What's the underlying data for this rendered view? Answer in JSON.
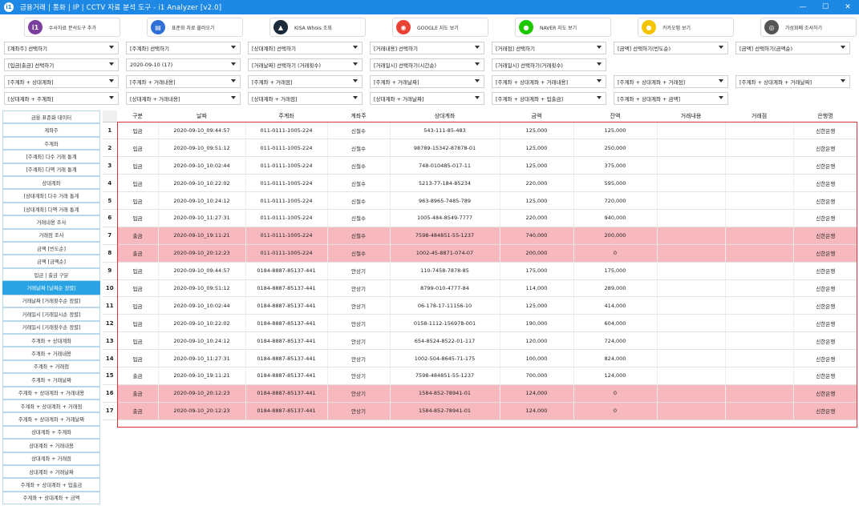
{
  "window": {
    "title": "금융거래 | 통화 | IP | CCTV 자료 분석 도구 - i1 Analyzer [v2.0]",
    "app_icon": "i1",
    "minimize": "—",
    "maximize": "☐",
    "close": "✕"
  },
  "toolbar": [
    {
      "label": "수사자료 분석도구 추가",
      "icon": "i1",
      "color": "#7b3fa0"
    },
    {
      "label": "표준화 자료 불러오기",
      "icon": "▤",
      "color": "#2f6fd6"
    },
    {
      "label": "KISA Whois 조회",
      "icon": "▲",
      "color": "#1b2b3a"
    },
    {
      "label": "GOOGLE 지도 보기",
      "icon": "◉",
      "color": "#e94235"
    },
    {
      "label": "NAVER 지도 보기",
      "icon": "●",
      "color": "#1ec800"
    },
    {
      "label": "카카오맵 보기",
      "icon": "●",
      "color": "#f4c400"
    },
    {
      "label": "가상화폐 조사하기",
      "icon": "◎",
      "color": "#555555"
    }
  ],
  "dropdowns": {
    "r1": [
      "[계좌주] 선택하기",
      "[주계좌] 선택하기",
      "[상대계좌] 선택하기",
      "[거래내용] 선택하기",
      "[거래점] 선택하기",
      "[금액] 선택하기(빈도순)",
      "[금액] 선택하기(금액순)"
    ],
    "r2": [
      "[입금|출금] 선택하기",
      "2020-09-10 (17)",
      "[거래날짜] 선택하기 (거래횟수)",
      "[거래일시] 선택하기(시간순)",
      "[거래일시] 선택하기(거래횟수)"
    ],
    "r3": [
      "[주계좌 + 상대계좌]",
      "[주계좌 + 거래내용]",
      "[주계좌 + 거래점]",
      "[주계좌 + 거래날짜]",
      "[주계좌 + 상대계좌 + 거래내용]",
      "[주계좌 + 상대계좌 + 거래점]",
      "[주계좌 + 상대계좌 + 거래날짜]"
    ],
    "r4": [
      "[상대계좌 + 주계좌]",
      "[상대계좌 + 거래내용]",
      "[상대계좌 + 거래점]",
      "[상대계좌 + 거래날짜]",
      "[주계좌 + 상대계좌 + 입출금]",
      "[주계좌 + 상대계좌 + 금액]"
    ]
  },
  "sidebar": [
    "금융 표준화 데이터",
    "계좌주",
    "주계좌",
    "[주계좌] 다수 거래 통계",
    "[주계좌] 다액 거래 통계",
    "상대계좌",
    "[상대계좌] 다수 거래 통계",
    "[상대계좌] 다액 거래 통계",
    "거래내용 조사",
    "거래점 조사",
    "금액 [빈도순]",
    "금액 [금액순]",
    "입금 | 출금 구분",
    "거래날짜 [날짜순 정렬]",
    "거래날짜 [거래횟수순 정렬]",
    "거래일시 [거래일시순 정렬]",
    "거래일시 [거래횟수순 정렬]",
    "주계좌 + 상대계좌",
    "주계좌 + 거래내용",
    "주계좌 + 거래점",
    "주계좌 + 거래날짜",
    "주계좌 + 상대계좌 + 거래내용",
    "주계좌 + 상대계좌 + 거래점",
    "주계좌 + 상대계좌 + 거래날짜",
    "상대계좌 + 주계좌",
    "상대계좌 + 거래내용",
    "상대계좌 + 거래점",
    "상대계좌 + 거래날짜",
    "주계좌 + 상대계좌 + 입출금",
    "주계좌 + 상대계좌 + 금액"
  ],
  "sidebar_active": "거래날짜 [날짜순 정렬]",
  "table": {
    "columns": [
      "구분",
      "날짜",
      "주계좌",
      "계좌주",
      "상대계좌",
      "금액",
      "잔액",
      "거래내용",
      "거래점",
      "은행명"
    ],
    "rows": [
      {
        "n": "1",
        "highlight": false,
        "cells": [
          "입금",
          "2020-09-10_09:44:57",
          "011-0111-1005-224",
          "신철수",
          "543-111-85-483",
          "125,000",
          "125,000",
          "",
          "",
          "신한은행"
        ]
      },
      {
        "n": "2",
        "highlight": false,
        "cells": [
          "입금",
          "2020-09-10_09:51:12",
          "011-0111-1005-224",
          "신철수",
          "98789-15342-87878-01",
          "125,000",
          "250,000",
          "",
          "",
          "신한은행"
        ]
      },
      {
        "n": "3",
        "highlight": false,
        "cells": [
          "입금",
          "2020-09-10_10:02:44",
          "011-0111-1005-224",
          "신철수",
          "748-010485-017-11",
          "125,000",
          "375,000",
          "",
          "",
          "신한은행"
        ]
      },
      {
        "n": "4",
        "highlight": false,
        "cells": [
          "입금",
          "2020-09-10_10:22:02",
          "011-0111-1005-224",
          "신철수",
          "5213-77-184-85234",
          "220,000",
          "595,000",
          "",
          "",
          "신한은행"
        ]
      },
      {
        "n": "5",
        "highlight": false,
        "cells": [
          "입금",
          "2020-09-10_10:24:12",
          "011-0111-1005-224",
          "신철수",
          "963-8965-7485-789",
          "125,000",
          "720,000",
          "",
          "",
          "신한은행"
        ]
      },
      {
        "n": "6",
        "highlight": false,
        "cells": [
          "입금",
          "2020-09-10_11:27:31",
          "011-0111-1005-224",
          "신철수",
          "1005-484-8549-7777",
          "220,000",
          "940,000",
          "",
          "",
          "신한은행"
        ]
      },
      {
        "n": "7",
        "highlight": true,
        "cells": [
          "출금",
          "2020-09-10_19:11:21",
          "011-0111-1005-224",
          "신철수",
          "7598-484851-55-1237",
          "740,000",
          "200,000",
          "",
          "",
          "신한은행"
        ]
      },
      {
        "n": "8",
        "highlight": true,
        "cells": [
          "출금",
          "2020-09-10_20:12:23",
          "011-0111-1005-224",
          "신철수",
          "1002-45-8871-074-07",
          "200,000",
          "0",
          "",
          "",
          "신한은행"
        ]
      },
      {
        "n": "9",
        "highlight": false,
        "cells": [
          "입금",
          "2020-09-10_09:44:57",
          "0184-8887-85137-441",
          "안상기",
          "110-7458-7878-85",
          "175,000",
          "175,000",
          "",
          "",
          "신한은행"
        ]
      },
      {
        "n": "10",
        "highlight": false,
        "cells": [
          "입금",
          "2020-09-10_09:51:12",
          "0184-8887-85137-441",
          "안상기",
          "8799-010-4777-84",
          "114,000",
          "289,000",
          "",
          "",
          "신한은행"
        ]
      },
      {
        "n": "11",
        "highlight": false,
        "cells": [
          "입금",
          "2020-09-10_10:02:44",
          "0184-8887-85137-441",
          "안상기",
          "06-178-17-11156-10",
          "125,000",
          "414,000",
          "",
          "",
          "신한은행"
        ]
      },
      {
        "n": "12",
        "highlight": false,
        "cells": [
          "입금",
          "2020-09-10_10:22:02",
          "0184-8887-85137-441",
          "안상기",
          "0158-1112-156978-001",
          "190,000",
          "604,000",
          "",
          "",
          "신한은행"
        ]
      },
      {
        "n": "13",
        "highlight": false,
        "cells": [
          "입금",
          "2020-09-10_10:24:12",
          "0184-8887-85137-441",
          "안상기",
          "654-8524-8522-01-117",
          "120,000",
          "724,000",
          "",
          "",
          "신한은행"
        ]
      },
      {
        "n": "14",
        "highlight": false,
        "cells": [
          "입금",
          "2020-09-10_11:27:31",
          "0184-8887-85137-441",
          "안상기",
          "1002-504-8645-71-175",
          "100,000",
          "824,000",
          "",
          "",
          "신한은행"
        ]
      },
      {
        "n": "15",
        "highlight": false,
        "cells": [
          "출금",
          "2020-09-10_19:11:21",
          "0184-8887-85137-441",
          "안상기",
          "7598-484851-55-1237",
          "700,000",
          "124,000",
          "",
          "",
          "신한은행"
        ]
      },
      {
        "n": "16",
        "highlight": true,
        "cells": [
          "출금",
          "2020-09-10_20:12:23",
          "0184-8887-85137-441",
          "안상기",
          "1584-852-78941-01",
          "124,000",
          "0",
          "",
          "",
          "신한은행"
        ]
      },
      {
        "n": "17",
        "highlight": true,
        "cells": [
          "출금",
          "2020-09-10_20:12:23",
          "0184-8887-85137-441",
          "안상기",
          "1584-852-78941-01",
          "124,000",
          "0",
          "",
          "",
          "신한은행"
        ]
      }
    ]
  },
  "colors": {
    "titlebar": "#1e88e5",
    "sidebar_active": "#29a3e3",
    "row_highlight": "#f7b9bd",
    "selection_border": "#d9313a"
  }
}
